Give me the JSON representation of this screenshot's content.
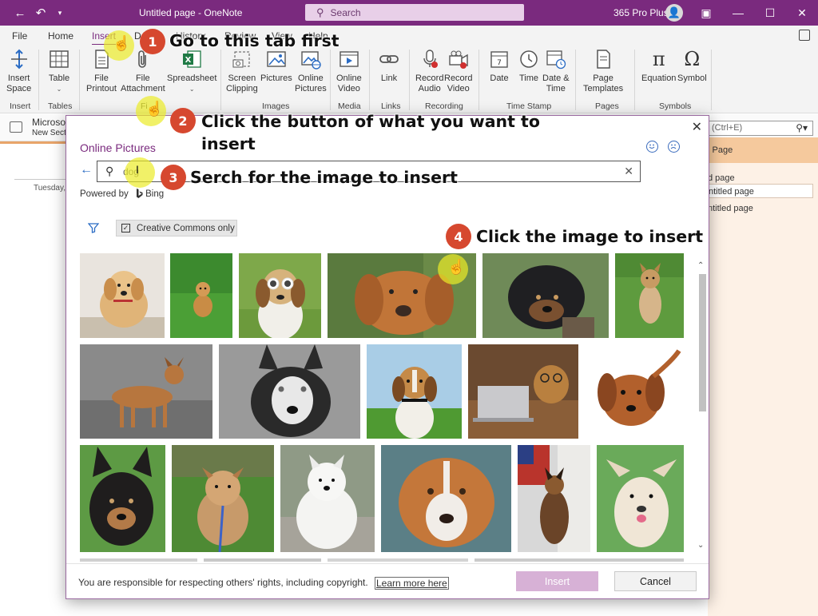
{
  "titlebar": {
    "title": "Untitled page  -  OneNote",
    "search_placeholder": "Search",
    "account": "365 Pro Plus",
    "back_glyph": "←",
    "undo_glyph": "↶",
    "min_glyph": "—",
    "max_glyph": "☐",
    "close_glyph": "✕",
    "ribbon_display_glyph": "▣"
  },
  "tabs": [
    "File",
    "Home",
    "Insert",
    "D",
    "History",
    "Review",
    "View",
    "Help"
  ],
  "ribbon": {
    "buttons": [
      {
        "label": "Insert\nSpace",
        "icon": "insert-space-icon"
      },
      {
        "label": "Table",
        "icon": "table-icon",
        "caret": true
      },
      {
        "label": "File\nPrintout",
        "icon": "file-printout-icon"
      },
      {
        "label": "File\nAttachment",
        "icon": "paperclip-icon"
      },
      {
        "label": "Spreadsheet",
        "icon": "excel-icon",
        "caret": true
      },
      {
        "label": "Screen\nClipping",
        "icon": "screen-clipping-icon"
      },
      {
        "label": "Pictures",
        "icon": "pictures-icon"
      },
      {
        "label": "Online\nPictures",
        "icon": "online-pictures-icon"
      },
      {
        "label": "Online\nVideo",
        "icon": "video-icon"
      },
      {
        "label": "Link",
        "icon": "link-icon"
      },
      {
        "label": "Record\nAudio",
        "icon": "microphone-icon"
      },
      {
        "label": "Record\nVideo",
        "icon": "camera-icon"
      },
      {
        "label": "Date",
        "icon": "calendar-icon"
      },
      {
        "label": "Time",
        "icon": "clock-icon"
      },
      {
        "label": "Date &\nTime",
        "icon": "calendar-clock-icon"
      },
      {
        "label": "Page\nTemplates",
        "icon": "page-templates-icon",
        "caret": true
      },
      {
        "label": "Equation",
        "icon": "pi-icon",
        "caret": true
      },
      {
        "label": "Symbol",
        "icon": "omega-icon",
        "caret": true
      }
    ],
    "groups": [
      "Insert",
      "Tables",
      "Fi",
      "Images",
      "Media",
      "Links",
      "Recording",
      "Time Stamp",
      "Pages",
      "Symbols"
    ]
  },
  "notebook": {
    "name": "Microso",
    "section": "New Secti",
    "date": "Tuesday,",
    "search_hint": "(Ctrl+E)",
    "pages_header": "l Page",
    "pages": [
      "d page",
      "ntitled page",
      "ntitled page"
    ]
  },
  "dialog": {
    "title": "Online Pictures",
    "search_value": "dog",
    "powered_by": "Powered by",
    "bing": "Bing",
    "cc_label": "Creative Commons only",
    "notice": "You are responsible for respecting others' rights, including copyright.",
    "learn_more": "Learn more here",
    "insert": "Insert",
    "cancel": "Cancel"
  },
  "annotations": [
    {
      "num": "1",
      "text": "Go to this tab first"
    },
    {
      "num": "2",
      "text": "Click the button of what you want to insert"
    },
    {
      "num": "3",
      "text": "Serch for the image to insert"
    },
    {
      "num": "4",
      "text": "Click the image to insert"
    }
  ],
  "colors": {
    "brand": "#7a2a7e",
    "step_circle": "#d6482f",
    "highlight": "#ebeb28",
    "insert_button": "#d7b1d6"
  }
}
